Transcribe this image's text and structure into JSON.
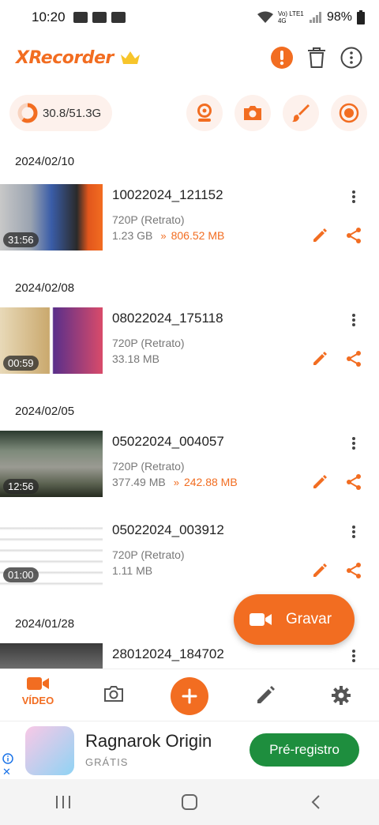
{
  "status_bar": {
    "time": "10:20",
    "battery": "98%",
    "network": "Vo) LTE1 4G"
  },
  "header": {
    "app_name": "XRecorder",
    "icons": [
      "crown-icon",
      "alert-icon",
      "trash-icon",
      "more-vert-icon"
    ]
  },
  "storage": {
    "text": "30.8/51.3G",
    "used_fraction": 0.6
  },
  "quick_actions": [
    "facecam-icon",
    "camera-icon",
    "brush-icon",
    "record-icon"
  ],
  "accent_color": "#f26d21",
  "sections": [
    {
      "date": "2024/02/10",
      "videos": [
        {
          "name": "10022024_121152",
          "resolution": "720P (Retrato)",
          "size": "1.23 GB",
          "compressed": "806.52 MB",
          "duration": "31:56"
        }
      ]
    },
    {
      "date": "2024/02/08",
      "videos": [
        {
          "name": "08022024_175118",
          "resolution": "720P (Retrato)",
          "size": "33.18 MB",
          "compressed": "",
          "duration": "00:59"
        }
      ]
    },
    {
      "date": "2024/02/05",
      "videos": [
        {
          "name": "05022024_004057",
          "resolution": "720P (Retrato)",
          "size": "377.49 MB",
          "compressed": "242.88 MB",
          "duration": "12:56"
        },
        {
          "name": "05022024_003912",
          "resolution": "720P (Retrato)",
          "size": "1.11 MB",
          "compressed": "",
          "duration": "01:00"
        }
      ]
    },
    {
      "date": "2024/01/28",
      "videos": [
        {
          "name": "28012024_184702",
          "resolution": "",
          "size": "",
          "compressed": "",
          "duration": ""
        }
      ]
    }
  ],
  "fab": {
    "label": "Gravar"
  },
  "bottom_nav": {
    "video_label": "VÍDEO"
  },
  "ad": {
    "title": "Ragnarok Origin",
    "subtitle": "GRÁTIS",
    "cta": "Pré-registro"
  }
}
